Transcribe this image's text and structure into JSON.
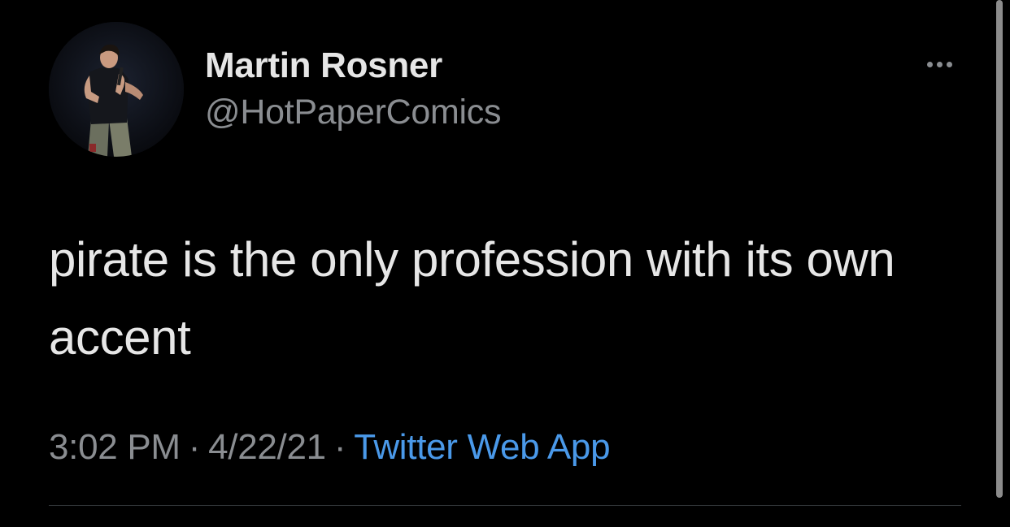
{
  "tweet": {
    "author": {
      "display_name": "Martin Rosner",
      "handle": "@HotPaperComics",
      "avatar_icon": "profile-photo"
    },
    "text": "pirate is the only profession with its own accent",
    "time": "3:02 PM",
    "date": "4/22/21",
    "separator": "·",
    "source": "Twitter Web App",
    "more_icon": "more-horizontal-icon"
  },
  "colors": {
    "background": "#000000",
    "primary_text": "#e6e6e6",
    "secondary_text": "#8a8d91",
    "link": "#4a99e9",
    "divider": "#2f3336"
  }
}
